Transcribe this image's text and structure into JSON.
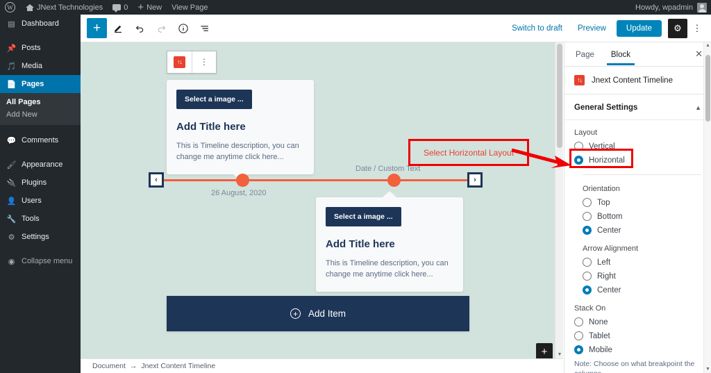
{
  "adminbar": {
    "site_name": "JNext Technologies",
    "comment_count": "0",
    "new_label": "New",
    "view_page_label": "View Page",
    "howdy": "Howdy, wpadmin"
  },
  "sidebar": {
    "items": [
      {
        "label": "Dashboard",
        "icon": "dashboard-icon",
        "glyph": "⌸"
      },
      {
        "label": "Posts",
        "icon": "pin-icon",
        "glyph": "✎"
      },
      {
        "label": "Media",
        "icon": "media-icon",
        "glyph": "♪"
      },
      {
        "label": "Pages",
        "icon": "pages-icon",
        "glyph": "▤"
      },
      {
        "label": "Comments",
        "icon": "comments-icon",
        "glyph": "▬"
      },
      {
        "label": "Appearance",
        "icon": "brush-icon",
        "glyph": "✒"
      },
      {
        "label": "Plugins",
        "icon": "plug-icon",
        "glyph": "⚙"
      },
      {
        "label": "Users",
        "icon": "users-icon",
        "glyph": "♟"
      },
      {
        "label": "Tools",
        "icon": "wrench-icon",
        "glyph": "⚒"
      },
      {
        "label": "Settings",
        "icon": "settings-icon",
        "glyph": "≡"
      },
      {
        "label": "Collapse menu",
        "icon": "collapse-icon",
        "glyph": "◉"
      }
    ],
    "submenu": [
      {
        "label": "All Pages"
      },
      {
        "label": "Add New"
      }
    ]
  },
  "header": {
    "add_block_label": "+",
    "edit_icon": "pencil-icon",
    "undo_icon": "undo-icon",
    "redo_icon": "redo-icon",
    "info_icon": "info-icon",
    "list_view_icon": "list-view-icon",
    "switch_to_draft": "Switch to draft",
    "preview": "Preview",
    "update": "Update",
    "settings_icon": "gear-icon",
    "more_icon": "kebab-icon"
  },
  "canvas": {
    "block_name": "Jnext Content Timeline",
    "block_icon_text": "↑↓",
    "cards": [
      {
        "image_button": "Select a image ...",
        "title": "Add Title here",
        "description": "This is Timeline description, you can change me anytime click here..."
      },
      {
        "image_button": "Select a image ...",
        "title": "Add Title here",
        "description": "This is Timeline description, you can change me anytime click here..."
      }
    ],
    "axis": {
      "label_left": "26 August, 2020",
      "label_right": "Date / Custom Text",
      "prev_arrow": "‹",
      "next_arrow": "›",
      "line_color": "#f2603c",
      "dot_color": "#f2603c"
    },
    "add_item_label": "Add Item",
    "canvas_add_block": "+",
    "background_color": "#d2e2dd"
  },
  "annotation": {
    "text": "Select Horizontal Layout",
    "color": "#f00000"
  },
  "settings_panel": {
    "tabs": [
      {
        "label": "Page",
        "active": false
      },
      {
        "label": "Block",
        "active": true
      }
    ],
    "close_label": "✕",
    "block_title": "Jnext Content Timeline",
    "section_title": "General Settings",
    "groups": [
      {
        "label": "Layout",
        "indented": false,
        "options": [
          {
            "label": "Vertical",
            "selected": false
          },
          {
            "label": "Horizontal",
            "selected": true
          }
        ]
      },
      {
        "label": "Orientation",
        "indented": true,
        "options": [
          {
            "label": "Top",
            "selected": false
          },
          {
            "label": "Bottom",
            "selected": false
          },
          {
            "label": "Center",
            "selected": true
          }
        ]
      },
      {
        "label": "Arrow Alignment",
        "indented": true,
        "options": [
          {
            "label": "Left",
            "selected": false
          },
          {
            "label": "Right",
            "selected": false
          },
          {
            "label": "Center",
            "selected": true
          }
        ]
      },
      {
        "label": "Stack On",
        "indented": false,
        "options": [
          {
            "label": "None",
            "selected": false
          },
          {
            "label": "Tablet",
            "selected": false
          },
          {
            "label": "Mobile",
            "selected": true
          }
        ]
      }
    ],
    "note": "Note: Choose on what breakpoint the columns",
    "accent_color": "#007cba"
  },
  "breadcrumb": {
    "root": "Document",
    "separator": "→",
    "current": "Jnext Content Timeline"
  }
}
